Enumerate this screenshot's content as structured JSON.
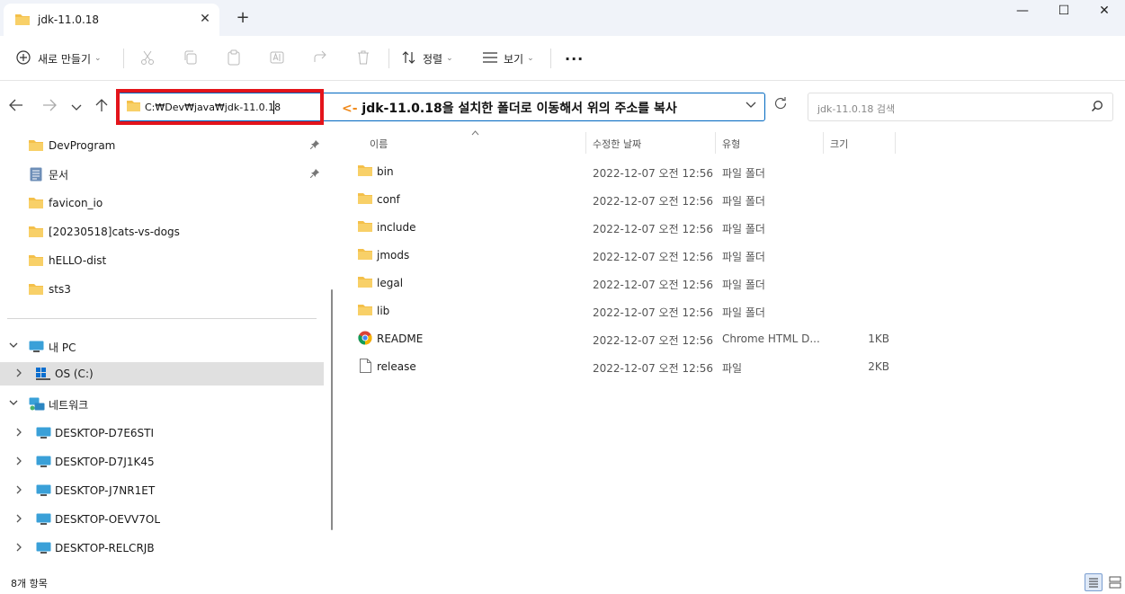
{
  "window": {
    "tab_title": "jdk-11.0.18",
    "tab_close": "✕",
    "new_tab": "+",
    "minimize": "—",
    "maximize": "☐",
    "close": "✕"
  },
  "toolbar": {
    "new_label": "새로 만들기",
    "sort_label": "정렬",
    "view_label": "보기",
    "more": "···"
  },
  "address": {
    "path": "C:₩Dev₩java₩jdk-11.0.18",
    "annotation_arrow": "<-",
    "annotation_text": "jdk-11.0.18을 설치한 폴더로 이동해서 위의 주소를 복사"
  },
  "search": {
    "placeholder": "jdk-11.0.18 검색"
  },
  "sidebar": {
    "quick_access": [
      {
        "label": "DevProgram",
        "icon": "folder-icon",
        "pinned": true
      },
      {
        "label": "문서",
        "icon": "document-icon",
        "pinned": true
      },
      {
        "label": "favicon_io",
        "icon": "folder-icon",
        "pinned": false
      },
      {
        "label": "[20230518]cats-vs-dogs",
        "icon": "folder-icon",
        "pinned": false
      },
      {
        "label": "hELLO-dist",
        "icon": "folder-icon",
        "pinned": false
      },
      {
        "label": "sts3",
        "icon": "folder-icon",
        "pinned": false
      }
    ],
    "this_pc": "내 PC",
    "drive": "OS (C:)",
    "network": "네트워크",
    "network_items": [
      "DESKTOP-D7E6STI",
      "DESKTOP-D7J1K45",
      "DESKTOP-J7NR1ET",
      "DESKTOP-OEVV7OL",
      "DESKTOP-RELCRJB"
    ]
  },
  "columns": {
    "name": "이름",
    "modified": "수정한 날짜",
    "type": "유형",
    "size": "크기"
  },
  "files": [
    {
      "name": "bin",
      "date": "2022-12-07 오전 12:56",
      "type": "파일 폴더",
      "size": "",
      "icon": "folder-icon"
    },
    {
      "name": "conf",
      "date": "2022-12-07 오전 12:56",
      "type": "파일 폴더",
      "size": "",
      "icon": "folder-icon"
    },
    {
      "name": "include",
      "date": "2022-12-07 오전 12:56",
      "type": "파일 폴더",
      "size": "",
      "icon": "folder-icon"
    },
    {
      "name": "jmods",
      "date": "2022-12-07 오전 12:56",
      "type": "파일 폴더",
      "size": "",
      "icon": "folder-icon"
    },
    {
      "name": "legal",
      "date": "2022-12-07 오전 12:56",
      "type": "파일 폴더",
      "size": "",
      "icon": "folder-icon"
    },
    {
      "name": "lib",
      "date": "2022-12-07 오전 12:56",
      "type": "파일 폴더",
      "size": "",
      "icon": "folder-icon"
    },
    {
      "name": "README",
      "date": "2022-12-07 오전 12:56",
      "type": "Chrome HTML D...",
      "size": "1KB",
      "icon": "chrome-icon"
    },
    {
      "name": "release",
      "date": "2022-12-07 오전 12:56",
      "type": "파일",
      "size": "2KB",
      "icon": "file-icon"
    }
  ],
  "status": {
    "count": "8개 항목"
  },
  "colors": {
    "folder": "#f4c04a",
    "accent": "#0067c0",
    "highlight_border": "#e3141b",
    "annotation_arrow": "#f08a1c"
  }
}
